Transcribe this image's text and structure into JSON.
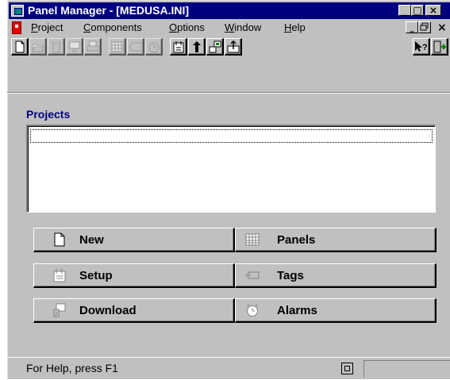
{
  "window": {
    "title": "Panel Manager - [MEDUSA.INI]",
    "caption_buttons": {
      "minimize": "_",
      "maximize": "□",
      "close": "×"
    }
  },
  "menu": {
    "items": [
      {
        "label": "Project",
        "mnemonic": "P"
      },
      {
        "label": "Components",
        "mnemonic": "C"
      },
      {
        "label": "Options",
        "mnemonic": "O"
      },
      {
        "label": "Window",
        "mnemonic": "W"
      },
      {
        "label": "Help",
        "mnemonic": "H"
      }
    ],
    "mdi_buttons": {
      "minimize": "_",
      "restore": "🗗",
      "close": "×"
    }
  },
  "toolbar": {
    "buttons": [
      {
        "icon": "new-document-icon",
        "enabled": true
      },
      {
        "icon": "open-folder-icon",
        "enabled": false
      },
      {
        "icon": "trash-icon",
        "enabled": false
      },
      {
        "icon": "download-icon",
        "enabled": false
      },
      {
        "icon": "print-icon",
        "enabled": false
      },
      {
        "icon": "panels-grid-icon",
        "enabled": false
      },
      {
        "icon": "tags-icon",
        "enabled": false
      },
      {
        "icon": "alarms-icon",
        "enabled": false
      },
      {
        "icon": "setup-icon",
        "enabled": true
      },
      {
        "icon": "upload-arrow-icon",
        "enabled": true
      },
      {
        "icon": "transfer-icon",
        "enabled": true
      },
      {
        "icon": "export-icon",
        "enabled": true
      },
      {
        "icon": "context-help-icon",
        "enabled": true
      },
      {
        "icon": "exit-icon",
        "enabled": true
      }
    ]
  },
  "projects": {
    "label": "Projects",
    "items": []
  },
  "actions": {
    "new": {
      "label": "New",
      "icon": "new-document-icon",
      "enabled": true
    },
    "setup": {
      "label": "Setup",
      "icon": "setup-icon",
      "enabled": false
    },
    "download": {
      "label": "Download",
      "icon": "download-icon",
      "enabled": false
    },
    "panels": {
      "label": "Panels",
      "icon": "panels-grid-icon",
      "enabled": false
    },
    "tags": {
      "label": "Tags",
      "icon": "tags-icon",
      "enabled": false
    },
    "alarms": {
      "label": "Alarms",
      "icon": "alarms-icon",
      "enabled": false
    }
  },
  "status": {
    "text": "For Help, press F1"
  },
  "colors": {
    "title_bar": "#000080",
    "face": "#c0c0c0",
    "projects_label": "#000080"
  }
}
